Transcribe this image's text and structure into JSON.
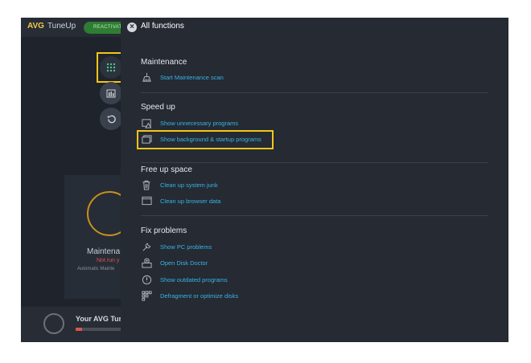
{
  "app": {
    "brand": "AVG",
    "product": "TuneUp",
    "reactivate_label": "REACTIVATE"
  },
  "background": {
    "card_title": "Maintena",
    "card_status": "Not run y",
    "card_sub": "Automatic Mainte",
    "bottom_title": "Your AVG Tune"
  },
  "panel": {
    "title": "All functions",
    "sections": [
      {
        "title": "Maintenance",
        "items": [
          {
            "label": "Start Maintenance scan",
            "icon": "broom-icon"
          }
        ]
      },
      {
        "title": "Speed up",
        "items": [
          {
            "label": "Show unnecessary programs",
            "icon": "program-warning-icon"
          },
          {
            "label": "Show background & startup programs",
            "icon": "windows-icon"
          }
        ]
      },
      {
        "title": "Free up space",
        "items": [
          {
            "label": "Clean up system junk",
            "icon": "trash-icon"
          },
          {
            "label": "Clean up browser data",
            "icon": "browser-icon"
          }
        ]
      },
      {
        "title": "Fix problems",
        "items": [
          {
            "label": "Show PC problems",
            "icon": "wrench-icon"
          },
          {
            "label": "Open Disk Doctor",
            "icon": "disk-doctor-icon"
          },
          {
            "label": "Show outdated programs",
            "icon": "outdated-icon"
          },
          {
            "label": "Defragment or optimize disks",
            "icon": "defrag-icon"
          }
        ]
      }
    ]
  },
  "colors": {
    "link": "#3ab4e6",
    "highlight": "#f5c518",
    "panel_bg": "#252a33"
  }
}
